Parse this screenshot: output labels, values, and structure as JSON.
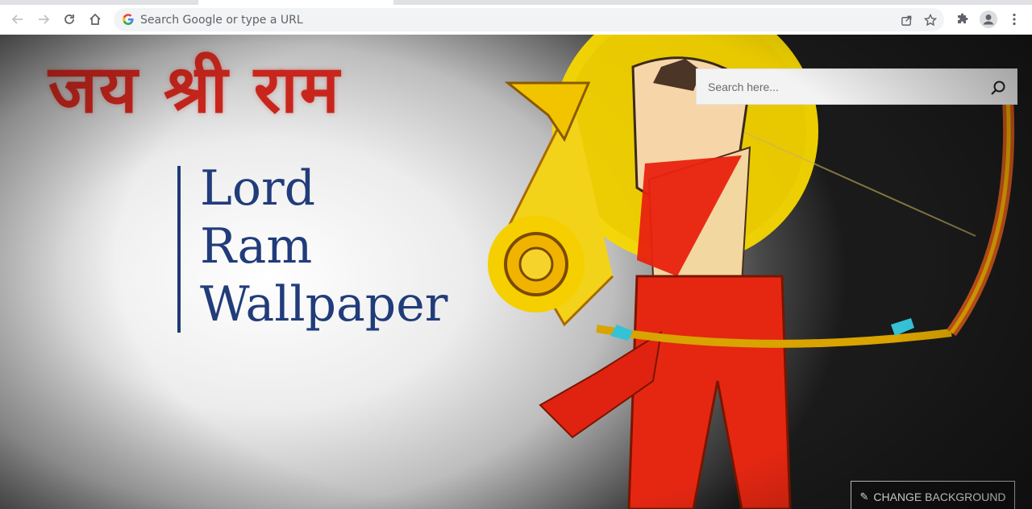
{
  "browser": {
    "omnibox_placeholder": "Search Google or type a URL",
    "icons": [
      "back-arrow-icon",
      "forward-arrow-icon",
      "reload-icon",
      "home-icon",
      "google-g-icon",
      "share-icon",
      "star-icon",
      "extensions-puzzle-icon",
      "profile-avatar-icon",
      "kebab-menu-icon"
    ]
  },
  "page": {
    "hindi_heading": "जय श्री राम",
    "title_lines": [
      "Lord",
      "Ram",
      "Wallpaper"
    ],
    "search_placeholder": "Search here...",
    "change_background_label": "CHANGE BACKGROUND",
    "colors": {
      "title": "#213c7a",
      "hindi": "#c8261d",
      "accent_bar": "#1f3a78"
    }
  }
}
